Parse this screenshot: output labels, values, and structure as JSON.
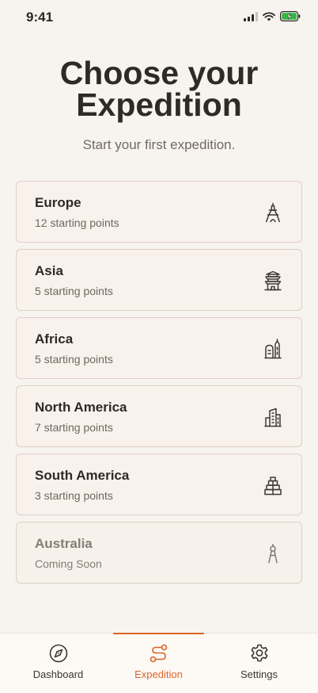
{
  "status_bar": {
    "time": "9:41"
  },
  "header": {
    "title_line1": "Choose your",
    "title_line2": "Expedition",
    "subtitle": "Start your first expedition."
  },
  "regions": [
    {
      "name": "Europe",
      "subtitle": "12 starting points",
      "icon": "eiffel-tower-icon",
      "enabled": true
    },
    {
      "name": "Asia",
      "subtitle": "5 starting points",
      "icon": "pagoda-icon",
      "enabled": true
    },
    {
      "name": "Africa",
      "subtitle": "5 starting points",
      "icon": "african-buildings-icon",
      "enabled": true
    },
    {
      "name": "North America",
      "subtitle": "7 starting points",
      "icon": "skyscraper-icon",
      "enabled": true
    },
    {
      "name": "South America",
      "subtitle": "3 starting points",
      "icon": "pyramid-icon",
      "enabled": true
    },
    {
      "name": "Australia",
      "subtitle": "Coming Soon",
      "icon": "compass-tool-icon",
      "enabled": false
    }
  ],
  "tab_bar": {
    "tabs": [
      {
        "label": "Dashboard",
        "icon": "compass-icon",
        "active": false
      },
      {
        "label": "Expedition",
        "icon": "route-icon",
        "active": true
      },
      {
        "label": "Settings",
        "icon": "gear-icon",
        "active": false
      }
    ]
  },
  "colors": {
    "background": "#f7f3ef",
    "card_border": "#dcd1c6",
    "accent": "#d8642a",
    "text_primary": "#2e2a26",
    "text_secondary": "#6f6861",
    "battery_green": "#3cb44a"
  }
}
